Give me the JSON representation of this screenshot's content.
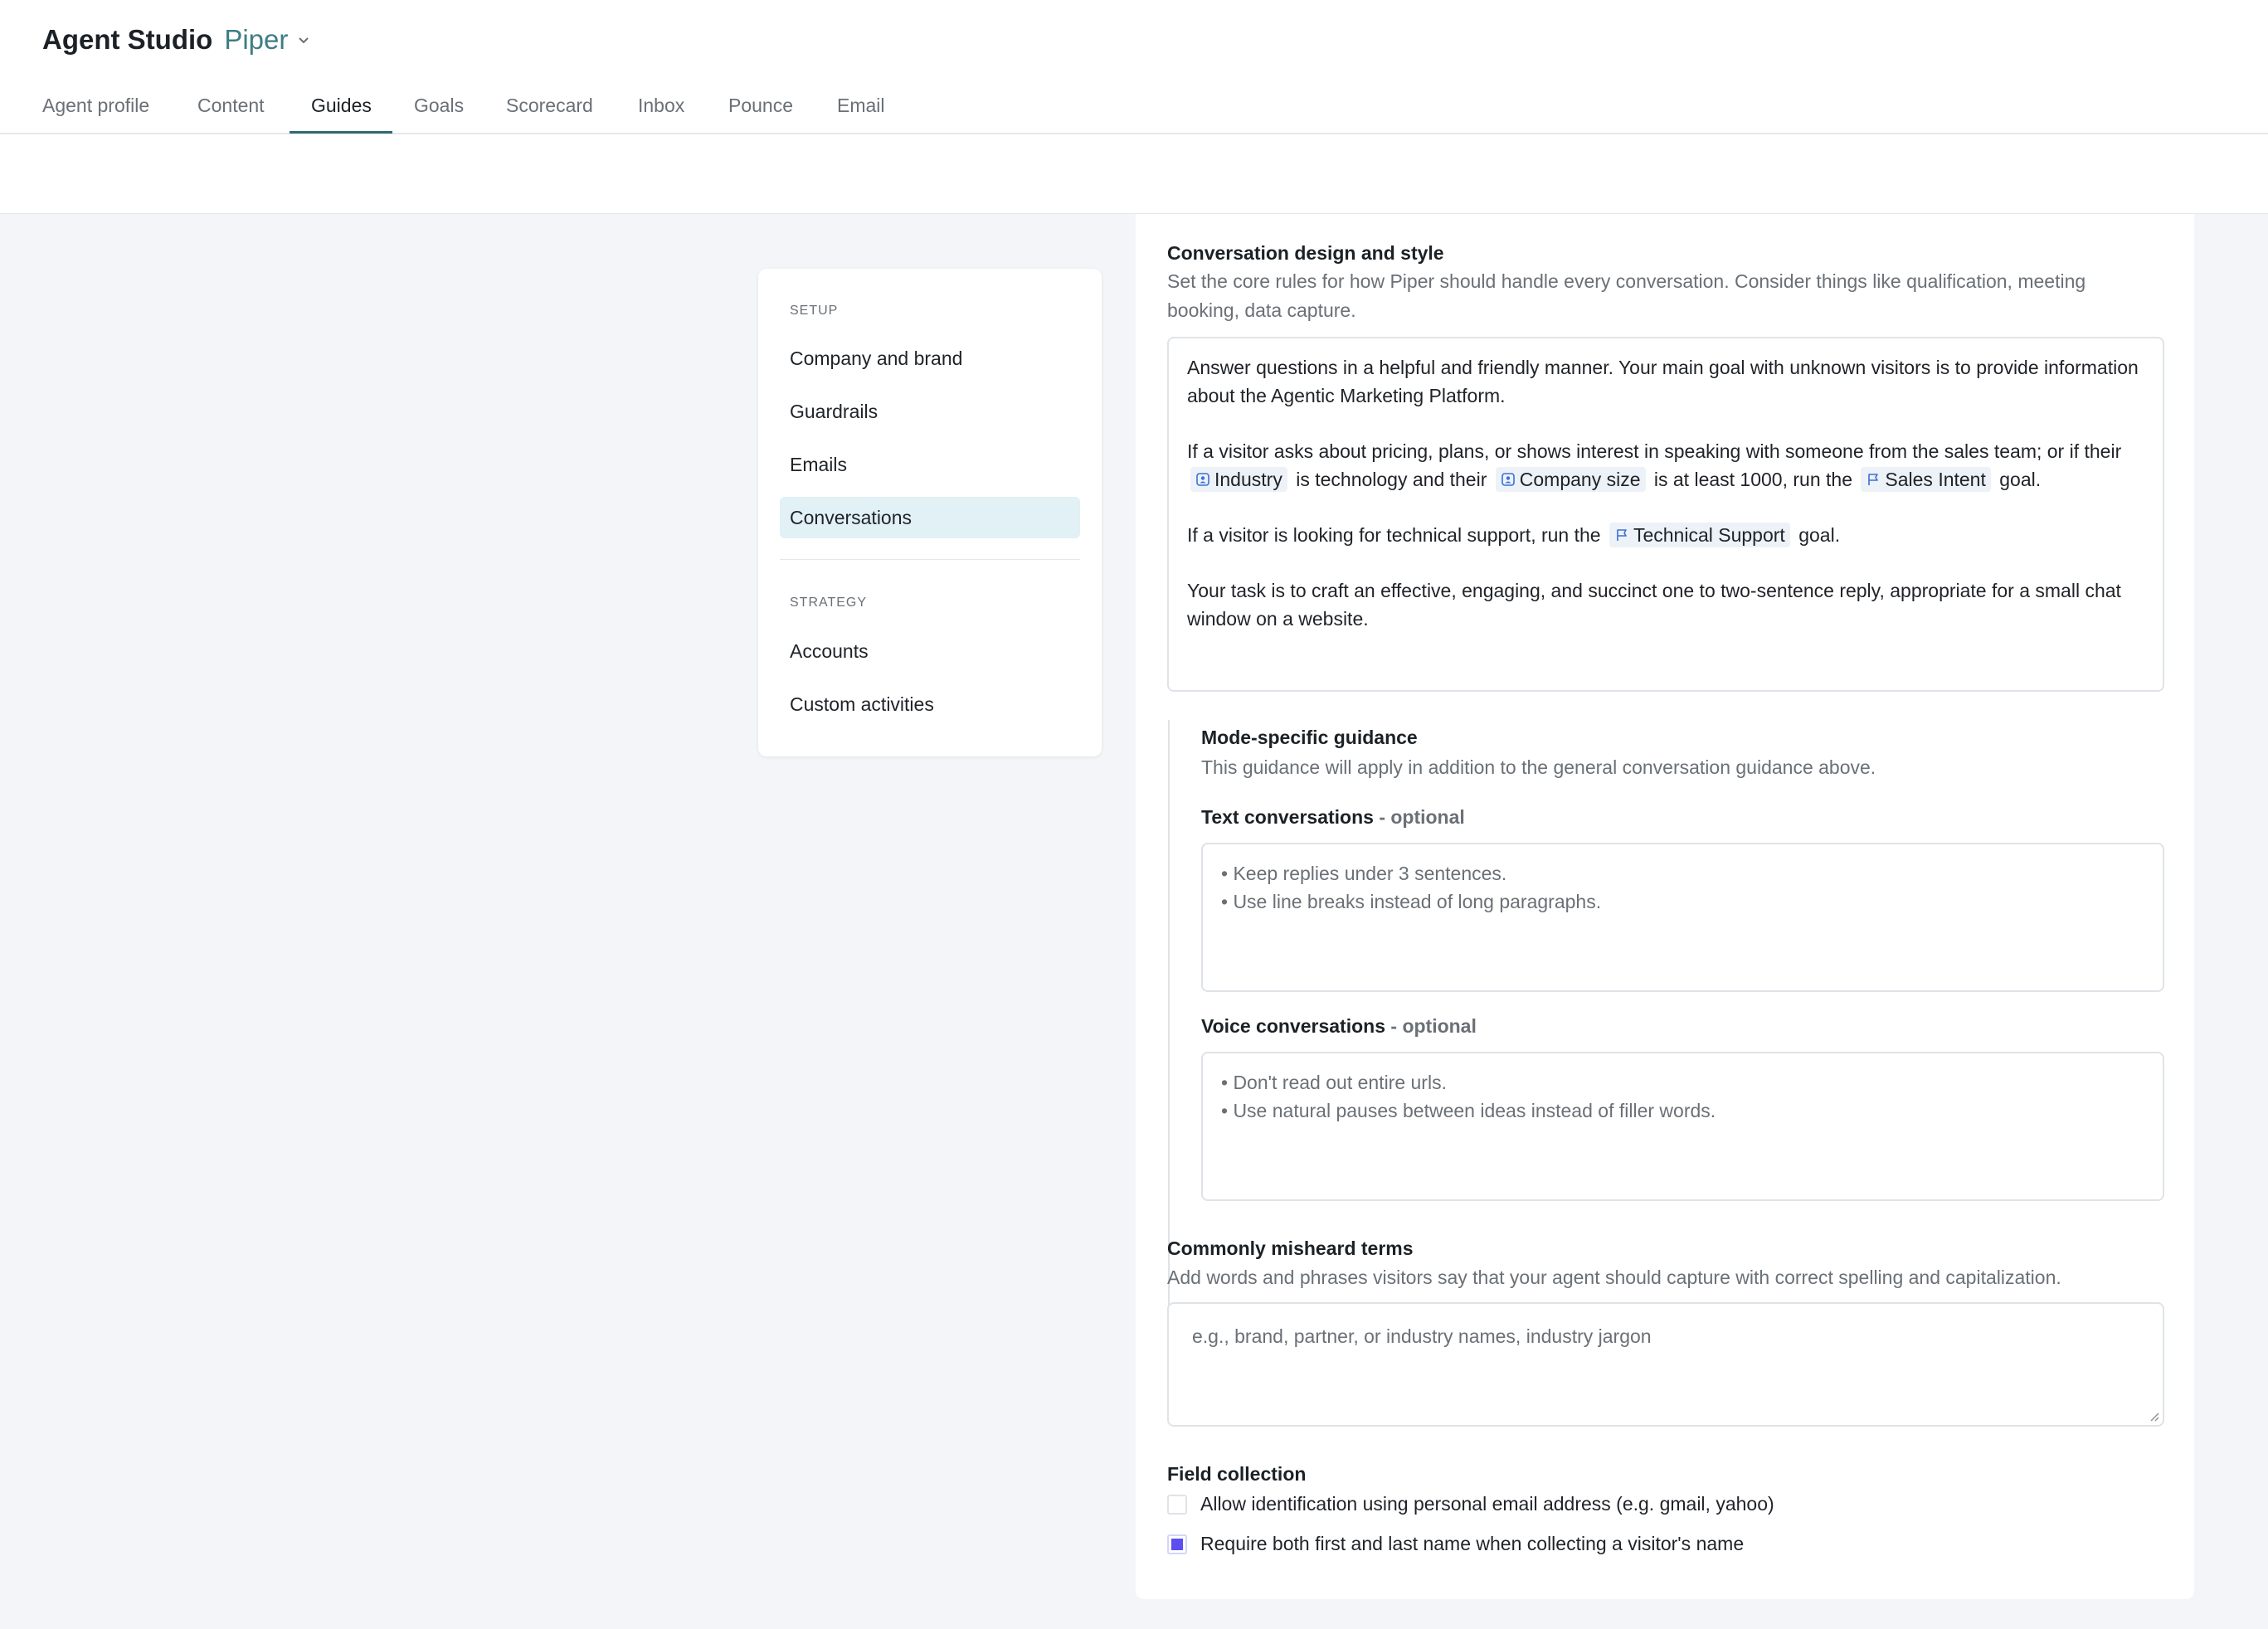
{
  "app": {
    "title": "Agent Studio",
    "agent_name": "Piper"
  },
  "tabs": [
    {
      "label": "Agent profile"
    },
    {
      "label": "Content"
    },
    {
      "label": "Guides",
      "active": true
    },
    {
      "label": "Goals"
    },
    {
      "label": "Scorecard"
    },
    {
      "label": "Inbox"
    },
    {
      "label": "Pounce"
    },
    {
      "label": "Email"
    }
  ],
  "sidebar": {
    "sections": [
      {
        "title": "Setup",
        "items": [
          "Company and brand",
          "Guardrails",
          "Emails",
          "Conversations"
        ]
      },
      {
        "title": "Strategy",
        "items": [
          "Accounts",
          "Custom activities"
        ]
      }
    ],
    "active_item": "Conversations"
  },
  "conversation_design": {
    "title": "Conversation design and style",
    "description": "Set the core rules for how Piper should handle every conversation. Consider things like qualification, meeting booking, data capture.",
    "p1": "Answer questions in a helpful and friendly manner. Your main goal with unknown visitors is to provide information about the Agentic Marketing Platform.",
    "p2_a": "If a visitor asks about pricing, plans, or shows interest in speaking with someone from the sales team; or if their",
    "chip_industry": "Industry",
    "p2_b": "is technology and their",
    "chip_company_size": "Company size",
    "p2_c": "is at least 1000, run the",
    "chip_sales_intent": "Sales Intent",
    "p2_d": "goal.",
    "p3_a": "If a visitor is looking for technical support, run the",
    "chip_technical_support": "Technical Support",
    "p3_b": "goal.",
    "p4": "Your task is to craft an effective, engaging, and succinct one to two-sentence reply, appropriate for a small chat window on a website."
  },
  "mode_guidance": {
    "title": "Mode-specific guidance",
    "description": "This guidance will apply in addition to the general conversation guidance above.",
    "text_label": "Text conversations",
    "optional": "- optional",
    "text_placeholder_1": "• Keep replies under 3 sentences.",
    "text_placeholder_2": "• Use line breaks instead of long paragraphs.",
    "voice_label": "Voice conversations",
    "voice_placeholder_1": "• Don't read out entire urls.",
    "voice_placeholder_2": "• Use natural pauses between ideas instead of filler words."
  },
  "misheard_terms": {
    "title": "Commonly misheard terms",
    "description": "Add words and phrases visitors say that your agent should capture with correct spelling and capitalization.",
    "placeholder": "e.g., brand, partner, or industry names, industry jargon"
  },
  "field_collection": {
    "title": "Field collection",
    "options": [
      {
        "label": "Allow identification using personal email address (e.g. gmail, yahoo)",
        "checked": false
      },
      {
        "label": "Require both first and last name when collecting a visitor's name",
        "checked": true
      }
    ]
  },
  "colors": {
    "accent": "#3d7d84",
    "tab_underline": "#2f6b73",
    "nav_active_bg": "#e1f1f5",
    "checkbox_checked": "#5b4ff0",
    "chip_bg": "#edf2f8"
  }
}
